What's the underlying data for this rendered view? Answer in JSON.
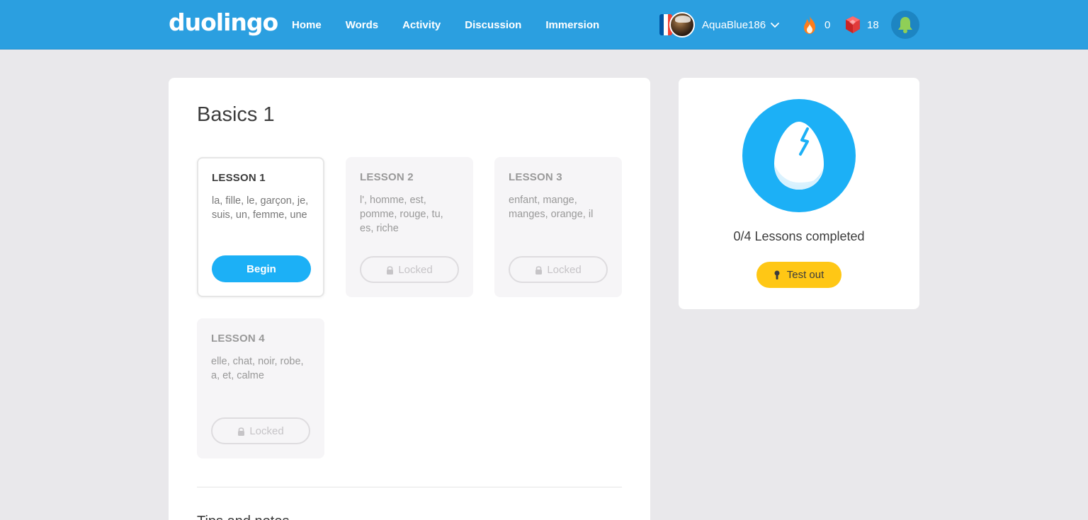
{
  "header": {
    "logo": "duolingo",
    "nav": [
      "Home",
      "Words",
      "Activity",
      "Discussion",
      "Immersion"
    ],
    "username": "AquaBlue186",
    "streak": "0",
    "gems": "18",
    "flag_colors": [
      "#0055a4",
      "#ffffff",
      "#ef4135"
    ]
  },
  "skill": {
    "title": "Basics 1",
    "lessons": [
      {
        "name": "LESSON 1",
        "words": "la, fille, le, garçon, je, suis, un, femme, une",
        "button": "Begin",
        "state": "active"
      },
      {
        "name": "LESSON 2",
        "words": "l', homme, est, pomme, rouge, tu, es, riche",
        "button": "Locked",
        "state": "locked"
      },
      {
        "name": "LESSON 3",
        "words": "enfant, mange, manges, orange, il",
        "button": "Locked",
        "state": "locked"
      },
      {
        "name": "LESSON 4",
        "words": "elle, chat, noir, robe, a, et, calme",
        "button": "Locked",
        "state": "locked"
      }
    ],
    "tips_heading": "Tips and notes"
  },
  "progress": {
    "completed_text": "0/4 Lessons completed",
    "test_out_label": "Test out"
  },
  "colors": {
    "header_blue": "#2b9fe0",
    "begin_blue": "#1cb0f6",
    "test_out_yellow": "#ffc715",
    "streak_orange": "#ff9600",
    "gem_red": "#d33131"
  },
  "icons": [
    "flame-icon",
    "gem-icon",
    "bell-icon",
    "lock-icon",
    "keyhole-icon",
    "cracked-egg-icon",
    "chevron-down-icon"
  ]
}
